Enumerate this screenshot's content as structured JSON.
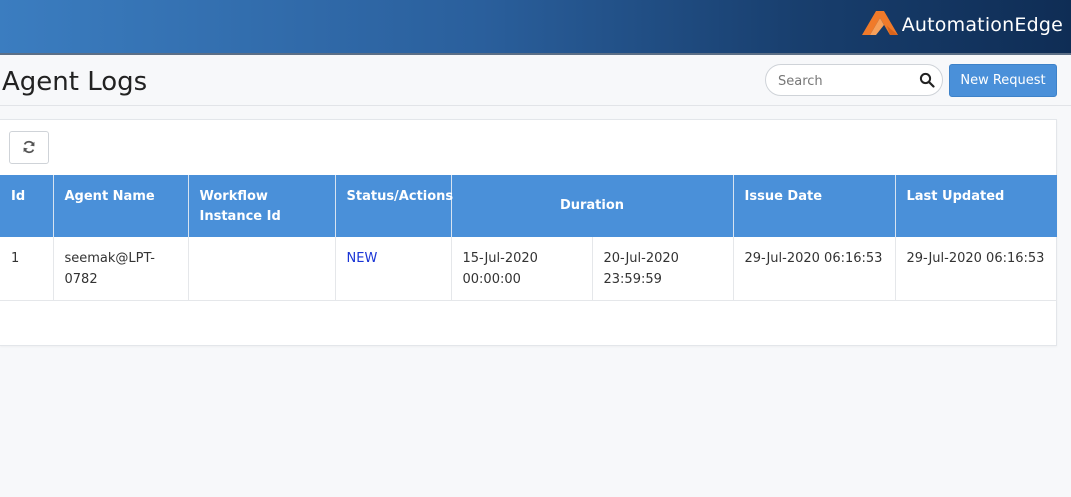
{
  "brand": {
    "name": "AutomationEdge",
    "logo_color": "#f07a2a"
  },
  "page": {
    "title": "Agent Logs"
  },
  "search": {
    "placeholder": "Search",
    "value": ""
  },
  "toolbar": {
    "new_request_label": "New Request",
    "refresh_icon": "refresh-icon"
  },
  "table": {
    "header_color": "#4a90d9",
    "columns": {
      "id": "Id",
      "agent_name": "Agent Name",
      "workflow_instance_id": "Workflow Instance Id",
      "status_actions": "Status/Actions",
      "duration": "Duration",
      "issue_date": "Issue Date",
      "last_updated": "Last Updated"
    },
    "rows": [
      {
        "id": "1",
        "agent_name": "seemak@LPT-0782",
        "workflow_instance_id": "",
        "status": "NEW",
        "duration_start": "15-Jul-2020 00:00:00",
        "duration_end": "20-Jul-2020 23:59:59",
        "issue_date": "29-Jul-2020 06:16:53",
        "last_updated": "29-Jul-2020 06:16:53"
      }
    ]
  }
}
